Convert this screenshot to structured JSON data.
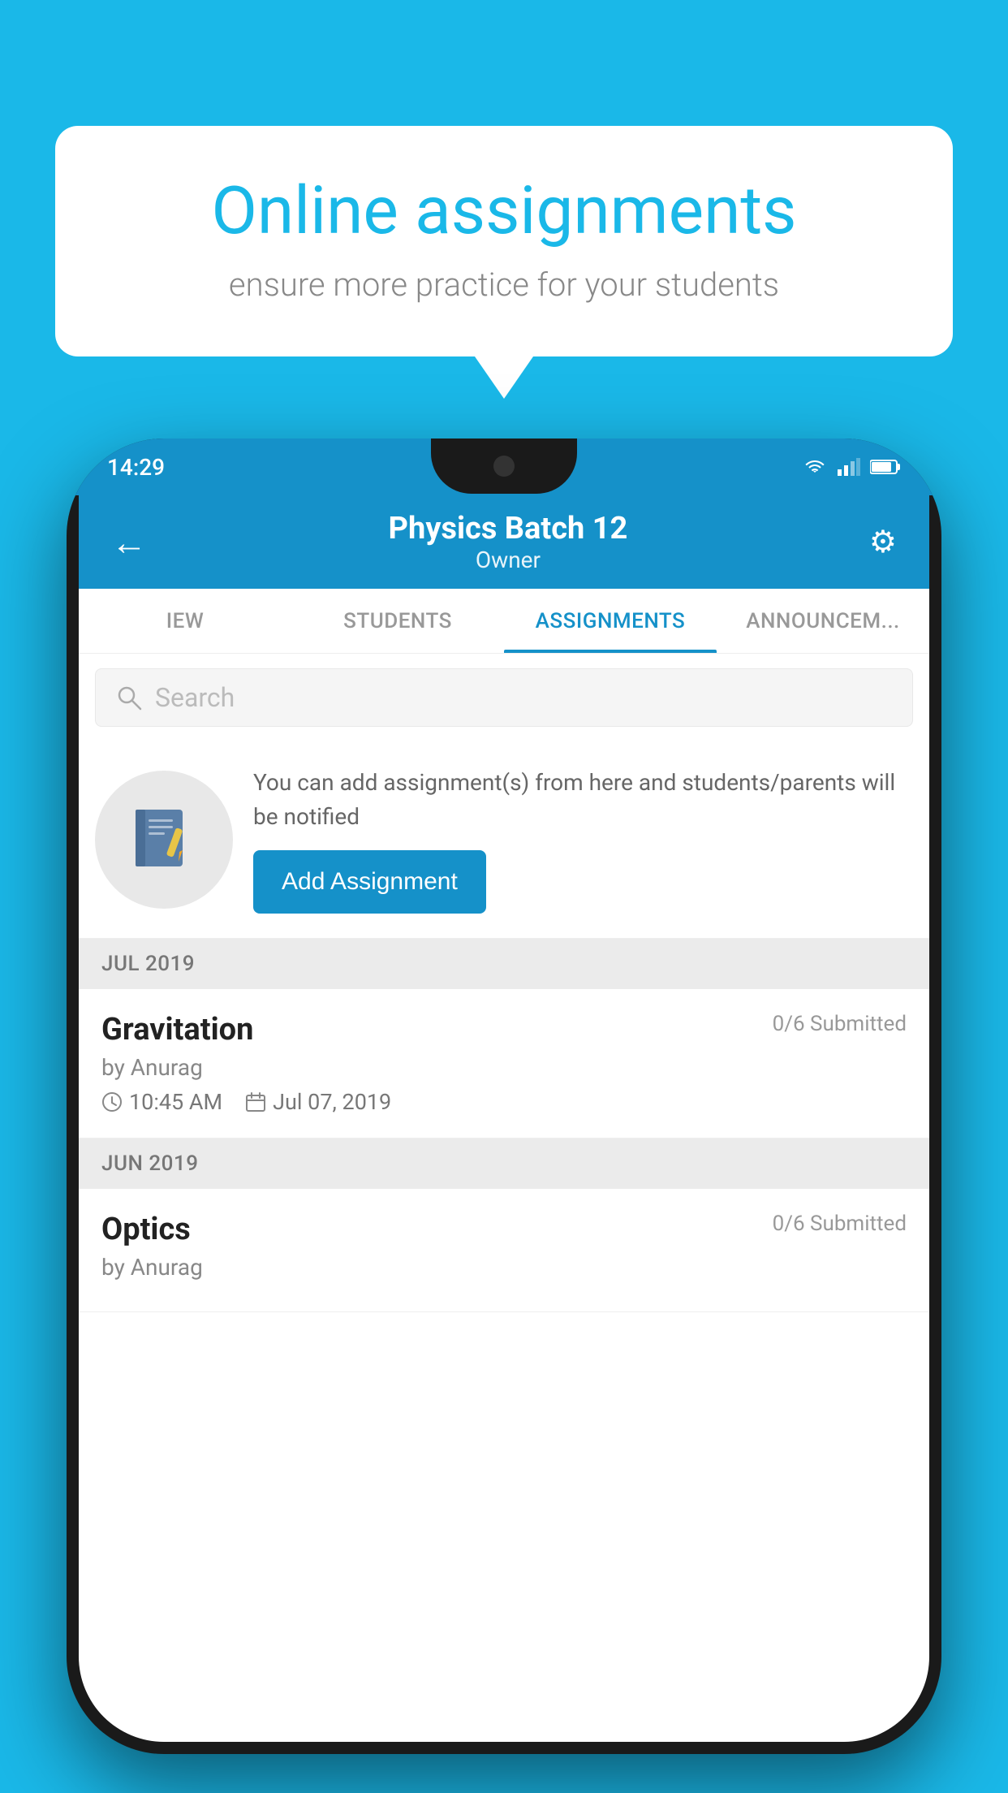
{
  "background_color": "#1ab8e8",
  "speech_bubble": {
    "title": "Online assignments",
    "subtitle": "ensure more practice for your students"
  },
  "phone": {
    "status_bar": {
      "time": "14:29",
      "icons": [
        "wifi",
        "signal",
        "battery"
      ]
    },
    "header": {
      "title": "Physics Batch 12",
      "subtitle": "Owner",
      "back_label": "←",
      "settings_label": "⚙"
    },
    "tabs": [
      {
        "label": "IEW",
        "active": false
      },
      {
        "label": "STUDENTS",
        "active": false
      },
      {
        "label": "ASSIGNMENTS",
        "active": true
      },
      {
        "label": "ANNOUNCEM...",
        "active": false
      }
    ],
    "search": {
      "placeholder": "Search"
    },
    "add_assignment_section": {
      "description": "You can add assignment(s) from here and students/parents will be notified",
      "button_label": "Add Assignment"
    },
    "assignment_groups": [
      {
        "month": "JUL 2019",
        "assignments": [
          {
            "name": "Gravitation",
            "submitted": "0/6 Submitted",
            "author": "by Anurag",
            "time": "10:45 AM",
            "date": "Jul 07, 2019"
          }
        ]
      },
      {
        "month": "JUN 2019",
        "assignments": [
          {
            "name": "Optics",
            "submitted": "0/6 Submitted",
            "author": "by Anurag",
            "time": "",
            "date": ""
          }
        ]
      }
    ]
  }
}
